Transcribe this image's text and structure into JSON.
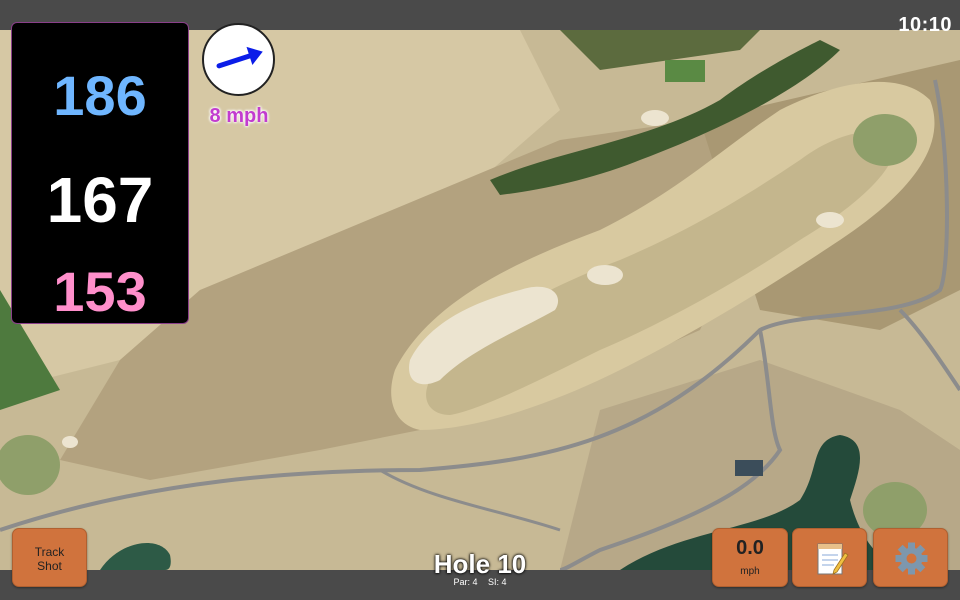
{
  "status_bar": {
    "time": "10:10"
  },
  "distances": {
    "back": "186",
    "middle": "167",
    "front": "153"
  },
  "wind": {
    "speed": "8 mph",
    "direction_icon": "arrow-icon"
  },
  "hole": {
    "title": "Hole 10",
    "par": "Par: 4",
    "si": "SI: 4"
  },
  "buttons": {
    "track_shot": "Track\nShot",
    "speed_value": "0.0",
    "speed_unit": "mph",
    "notes_icon": "notepad-icon",
    "settings_icon": "gear-icon"
  },
  "colors": {
    "back_distance": "#6fb6ff",
    "middle_distance": "#ffffff",
    "front_distance": "#ff8fcb",
    "button": "#d0733d",
    "wind_text": "#c23ccf"
  }
}
